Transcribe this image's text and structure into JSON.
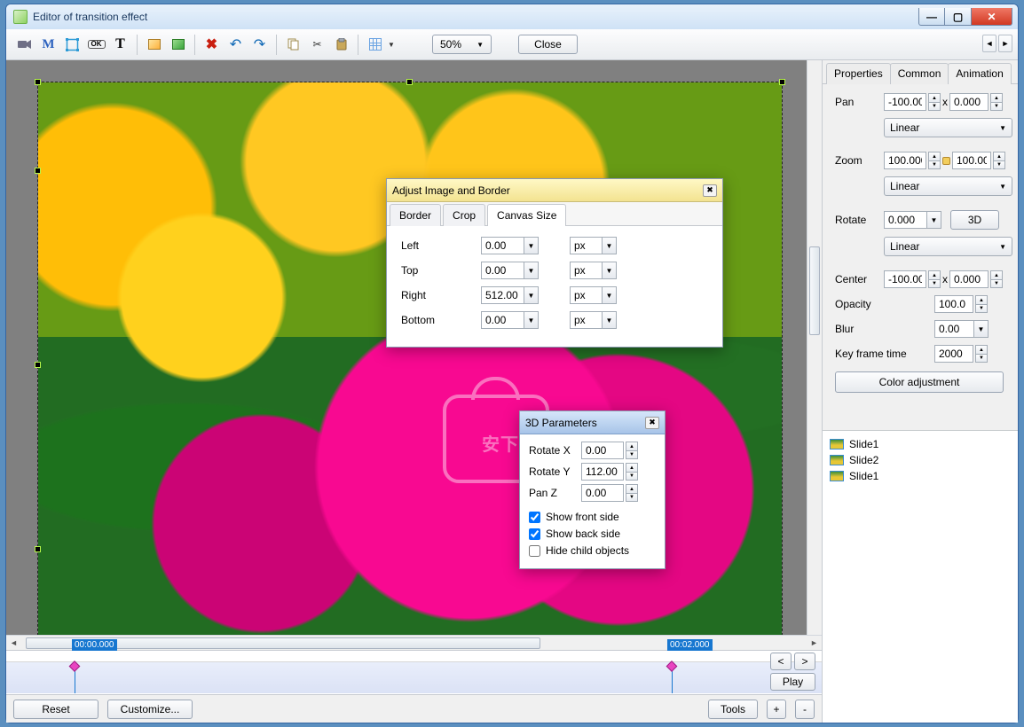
{
  "window": {
    "title": "Editor of transition effect"
  },
  "toolbar": {
    "zoom": "50%",
    "close": "Close"
  },
  "dialog_adjust": {
    "title": "Adjust Image and Border",
    "tabs": {
      "border": "Border",
      "crop": "Crop",
      "canvas": "Canvas Size"
    },
    "rows": {
      "left": {
        "label": "Left",
        "value": "0.00",
        "unit": "px"
      },
      "top": {
        "label": "Top",
        "value": "0.00",
        "unit": "px"
      },
      "right": {
        "label": "Right",
        "value": "512.00",
        "unit": "px"
      },
      "bottom": {
        "label": "Bottom",
        "value": "0.00",
        "unit": "px"
      }
    }
  },
  "dialog_3d": {
    "title": "3D Parameters",
    "rotate_x": {
      "label": "Rotate X",
      "value": "0.00"
    },
    "rotate_y": {
      "label": "Rotate Y",
      "value": "112.00"
    },
    "pan_z": {
      "label": "Pan Z",
      "value": "0.00"
    },
    "front": {
      "label": "Show front side",
      "checked": true
    },
    "back": {
      "label": "Show back side",
      "checked": true
    },
    "hide": {
      "label": "Hide child objects",
      "checked": false
    }
  },
  "panel": {
    "tabs": {
      "properties": "Properties",
      "common": "Common",
      "animation": "Animation"
    },
    "pan": {
      "label": "Pan",
      "x": "-100.000",
      "y": "0.000",
      "interp": "Linear"
    },
    "zoom": {
      "label": "Zoom",
      "x": "100.000",
      "y": "100.000",
      "interp": "Linear"
    },
    "rotate": {
      "label": "Rotate",
      "value": "0.000",
      "btn3d": "3D",
      "interp": "Linear"
    },
    "center": {
      "label": "Center",
      "x": "-100.000",
      "y": "0.000"
    },
    "opacity": {
      "label": "Opacity",
      "value": "100.0"
    },
    "blur": {
      "label": "Blur",
      "value": "0.00"
    },
    "keyframe": {
      "label": "Key frame time",
      "value": "2000"
    },
    "color_btn": "Color adjustment"
  },
  "slides": [
    "Slide1",
    "Slide2",
    "Slide1"
  ],
  "timeline": {
    "start": "00:00.000",
    "end": "00:02.000",
    "nav_prev": "<",
    "nav_next": ">",
    "play": "Play"
  },
  "bottom": {
    "reset": "Reset",
    "customize": "Customize...",
    "tools": "Tools",
    "plus": "+",
    "minus": "-"
  }
}
